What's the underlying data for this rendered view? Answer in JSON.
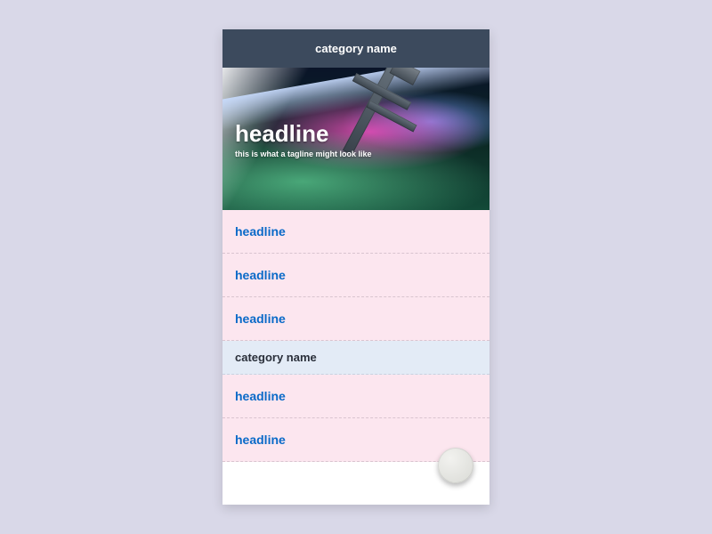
{
  "header": {
    "title": "category name"
  },
  "hero": {
    "headline": "headline",
    "tagline": "this is what a tagline might look like"
  },
  "list": {
    "items": [
      {
        "type": "item",
        "label": "headline"
      },
      {
        "type": "item",
        "label": "headline"
      },
      {
        "type": "item",
        "label": "headline"
      },
      {
        "type": "section",
        "label": "category name"
      },
      {
        "type": "item",
        "label": "headline"
      },
      {
        "type": "item",
        "label": "headline"
      }
    ]
  },
  "fab": {
    "icon": "circle"
  }
}
